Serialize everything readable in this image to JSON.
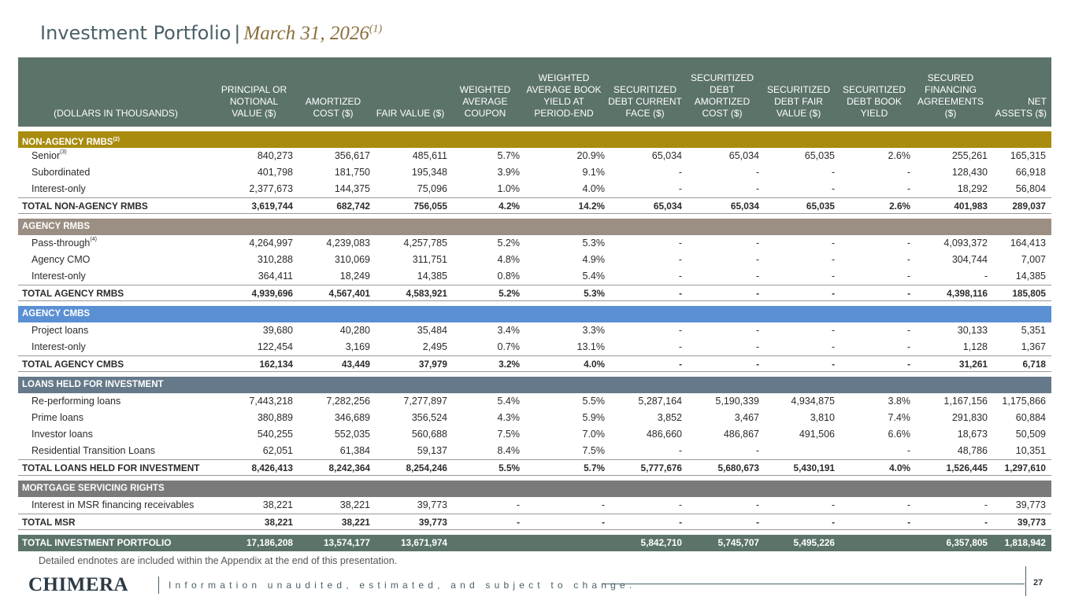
{
  "title": {
    "main": "Investment Portfolio",
    "sep": "|",
    "date": "March 31, 2026",
    "note": "(1)"
  },
  "columns": [
    "(DOLLARS IN THOUSANDS)",
    "PRINCIPAL OR NOTIONAL VALUE ($)",
    "AMORTIZED COST ($)",
    "FAIR VALUE ($)",
    "WEIGHTED AVERAGE COUPON",
    "WEIGHTED AVERAGE BOOK YIELD AT PERIOD-END",
    "SECURITIZED DEBT CURRENT FACE ($)",
    "SECURITIZED DEBT AMORTIZED COST ($)",
    "SECURITIZED DEBT FAIR VALUE ($)",
    "SECURITIZED DEBT BOOK YIELD",
    "SECURED FINANCING AGREEMENTS ($)",
    "NET ASSETS ($)"
  ],
  "colors": {
    "header": "#5b7369",
    "section_nonagency": "#a98c0e",
    "section_agency_rmbs": "#9b8e82",
    "section_agency_cmbs": "#5a8fd3",
    "section_loans": "#66798a",
    "section_msr": "#7a7a7a",
    "title_date": "#8a6f3c"
  },
  "sections": [
    {
      "label": "NON-AGENCY RMBS",
      "note": "(2)",
      "color": "#a98c0e",
      "rows": [
        {
          "label": "Senior",
          "note": "(3)",
          "v": [
            "840,273",
            "356,617",
            "485,611",
            "5.7%",
            "20.9%",
            "65,034",
            "65,034",
            "65,035",
            "2.6%",
            "255,261",
            "165,315"
          ]
        },
        {
          "label": "Subordinated",
          "note": "",
          "v": [
            "401,798",
            "181,750",
            "195,348",
            "3.9%",
            "9.1%",
            "-",
            "-",
            "-",
            "-",
            "128,430",
            "66,918"
          ]
        },
        {
          "label": "Interest-only",
          "note": "",
          "v": [
            "2,377,673",
            "144,375",
            "75,096",
            "1.0%",
            "4.0%",
            "-",
            "-",
            "-",
            "-",
            "18,292",
            "56,804"
          ]
        }
      ],
      "total": {
        "label": "TOTAL NON-AGENCY RMBS",
        "v": [
          "3,619,744",
          "682,742",
          "756,055",
          "4.2%",
          "14.2%",
          "65,034",
          "65,034",
          "65,035",
          "2.6%",
          "401,983",
          "289,037"
        ]
      }
    },
    {
      "label": "AGENCY RMBS",
      "note": "",
      "color": "#9b8e82",
      "rows": [
        {
          "label": "Pass-through",
          "note": "(4)",
          "v": [
            "4,264,997",
            "4,239,083",
            "4,257,785",
            "5.2%",
            "5.3%",
            "-",
            "-",
            "-",
            "-",
            "4,093,372",
            "164,413"
          ]
        },
        {
          "label": "Agency CMO",
          "note": "",
          "v": [
            "310,288",
            "310,069",
            "311,751",
            "4.8%",
            "4.9%",
            "-",
            "-",
            "-",
            "-",
            "304,744",
            "7,007"
          ]
        },
        {
          "label": "Interest-only",
          "note": "",
          "v": [
            "364,411",
            "18,249",
            "14,385",
            "0.8%",
            "5.4%",
            "-",
            "-",
            "-",
            "-",
            "-",
            "14,385"
          ]
        }
      ],
      "total": {
        "label": "TOTAL AGENCY RMBS",
        "v": [
          "4,939,696",
          "4,567,401",
          "4,583,921",
          "5.2%",
          "5.3%",
          "-",
          "-",
          "-",
          "-",
          "4,398,116",
          "185,805"
        ]
      }
    },
    {
      "label": "AGENCY CMBS",
      "note": "",
      "color": "#5a8fd3",
      "rows": [
        {
          "label": "Project loans",
          "note": "",
          "v": [
            "39,680",
            "40,280",
            "35,484",
            "3.4%",
            "3.3%",
            "-",
            "-",
            "-",
            "-",
            "30,133",
            "5,351"
          ]
        },
        {
          "label": "Interest-only",
          "note": "",
          "v": [
            "122,454",
            "3,169",
            "2,495",
            "0.7%",
            "13.1%",
            "-",
            "-",
            "-",
            "-",
            "1,128",
            "1,367"
          ]
        }
      ],
      "total": {
        "label": "TOTAL AGENCY CMBS",
        "v": [
          "162,134",
          "43,449",
          "37,979",
          "3.2%",
          "4.0%",
          "-",
          "-",
          "-",
          "-",
          "31,261",
          "6,718"
        ]
      }
    },
    {
      "label": "LOANS HELD FOR INVESTMENT",
      "note": "",
      "color": "#66798a",
      "rows": [
        {
          "label": "Re-performing loans",
          "note": "",
          "v": [
            "7,443,218",
            "7,282,256",
            "7,277,897",
            "5.4%",
            "5.5%",
            "5,287,164",
            "5,190,339",
            "4,934,875",
            "3.8%",
            "1,167,156",
            "1,175,866"
          ]
        },
        {
          "label": "Prime loans",
          "note": "",
          "v": [
            "380,889",
            "346,689",
            "356,524",
            "4.3%",
            "5.9%",
            "3,852",
            "3,467",
            "3,810",
            "7.4%",
            "291,830",
            "60,884"
          ]
        },
        {
          "label": "Investor loans",
          "note": "",
          "v": [
            "540,255",
            "552,035",
            "560,688",
            "7.5%",
            "7.0%",
            "486,660",
            "486,867",
            "491,506",
            "6.6%",
            "18,673",
            "50,509"
          ]
        },
        {
          "label": "Residential Transition Loans",
          "note": "",
          "v": [
            "62,051",
            "61,384",
            "59,137",
            "8.4%",
            "7.5%",
            "-",
            "-",
            "",
            "-",
            "48,786",
            "10,351"
          ]
        }
      ],
      "total": {
        "label": "TOTAL LOANS HELD FOR INVESTMENT",
        "v": [
          "8,426,413",
          "8,242,364",
          "8,254,246",
          "5.5%",
          "5.7%",
          "5,777,676",
          "5,680,673",
          "5,430,191",
          "4.0%",
          "1,526,445",
          "1,297,610"
        ]
      }
    },
    {
      "label": "MORTGAGE SERVICING RIGHTS",
      "note": "",
      "color": "#7a7a7a",
      "rows": [
        {
          "label": "Interest in MSR financing receivables",
          "note": "",
          "v": [
            "38,221",
            "38,221",
            "39,773",
            "-",
            "-",
            "-",
            "-",
            "-",
            "-",
            "-",
            "39,773"
          ]
        }
      ],
      "total": {
        "label": "TOTAL MSR",
        "v": [
          "38,221",
          "38,221",
          "39,773",
          "-",
          "-",
          "-",
          "-",
          "-",
          "-",
          "-",
          "39,773"
        ]
      }
    }
  ],
  "grand_total": {
    "label": "TOTAL INVESTMENT PORTFOLIO",
    "v": [
      "17,186,208",
      "13,574,177",
      "13,671,974",
      "",
      "",
      "5,842,710",
      "5,745,707",
      "5,495,226",
      "",
      "6,357,805",
      "1,818,942"
    ]
  },
  "endnote": "Detailed endnotes are included within the Appendix at the end of this presentation.",
  "footer": {
    "logo": "CHIMERA",
    "tagline": "Information unaudited, estimated, and subject to change.",
    "page": "27"
  }
}
